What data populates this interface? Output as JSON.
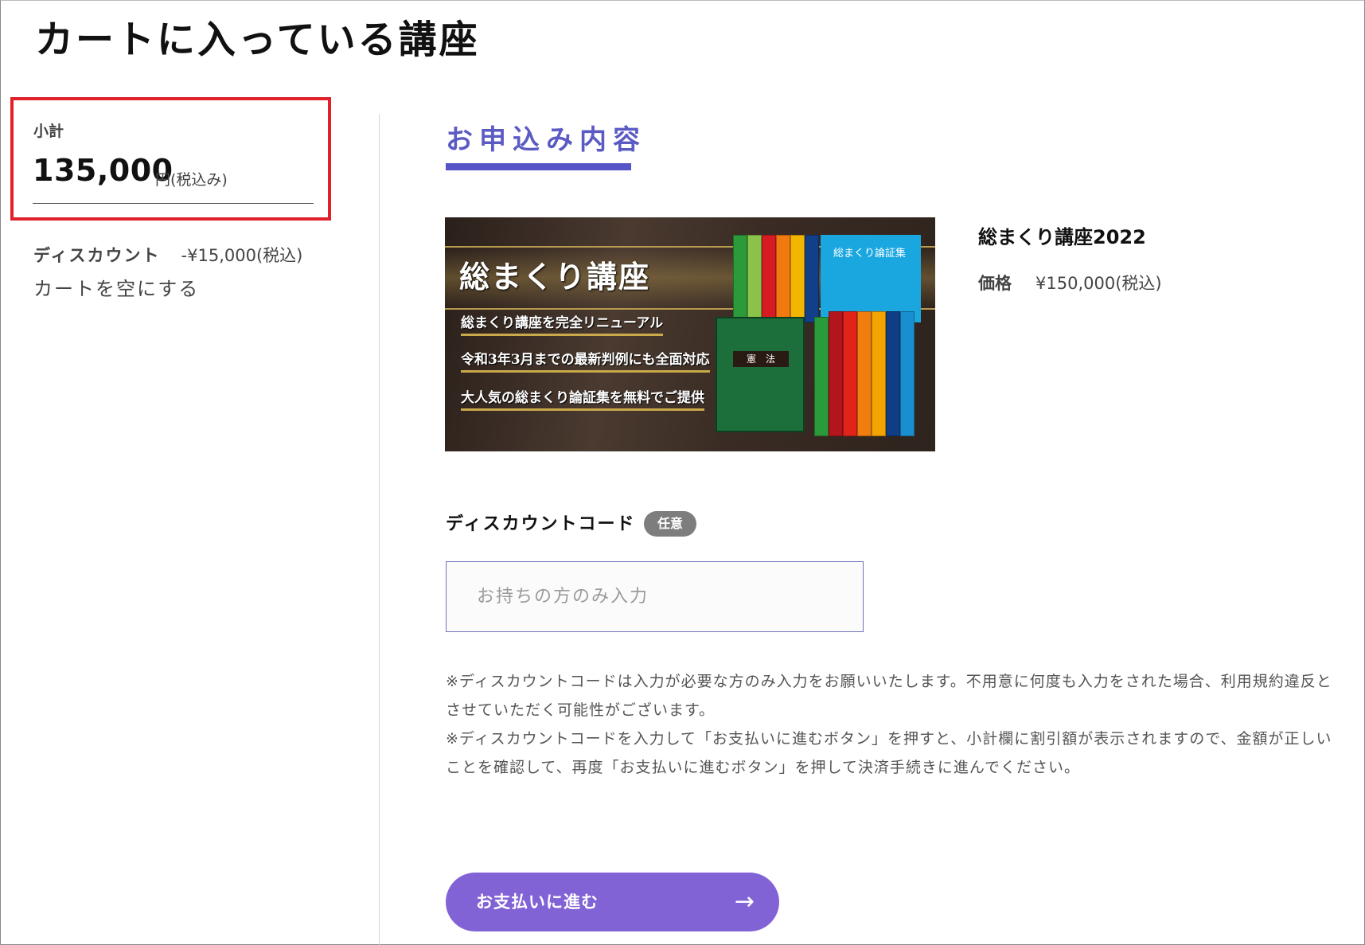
{
  "page": {
    "title": "カートに入っている講座"
  },
  "summary": {
    "subtotal_label": "小計",
    "subtotal_amount": "135,000",
    "subtotal_unit": "円(税込み)",
    "discount_label": "ディスカウント",
    "discount_value": "-¥15,000(税込)",
    "empty_cart_link": "カートを空にする"
  },
  "order": {
    "section_title": "お申込み内容",
    "banner": {
      "title": "総まくり講座",
      "lines": [
        "総まくり講座を完全リニューアル",
        "令和3年3月までの最新判例にも全面対応",
        "大人気の総まくり論証集を無料でご提供"
      ],
      "book_title": "総まくり論証集",
      "green_book_label": "憲　法"
    },
    "product_name": "総まくり講座2022",
    "price_label": "価格",
    "price_value": "¥150,000(税込)"
  },
  "discount_code": {
    "label": "ディスカウントコード",
    "badge": "任意",
    "placeholder": "お持ちの方のみ入力",
    "value": "",
    "note1": "※ディスカウントコードは入力が必要な方のみ入力をお願いいたします。不用意に何度も入力をされた場合、利用規約違反とさせていただく可能性がございます。",
    "note2": "※ディスカウントコードを入力して「お支払いに進むボタン」を押すと、小計欄に割引額が表示されますので、金額が正しいことを確認して、再度「お支払いに進むボタン」を押して決済手続きに進んでください。"
  },
  "actions": {
    "pay_button": "お支払いに進む",
    "pay_arrow": "→"
  },
  "colors": {
    "accent": "#5b5bc4",
    "button": "#8263d6",
    "highlight_border": "#e0212b",
    "badge": "#7d7d7d"
  }
}
